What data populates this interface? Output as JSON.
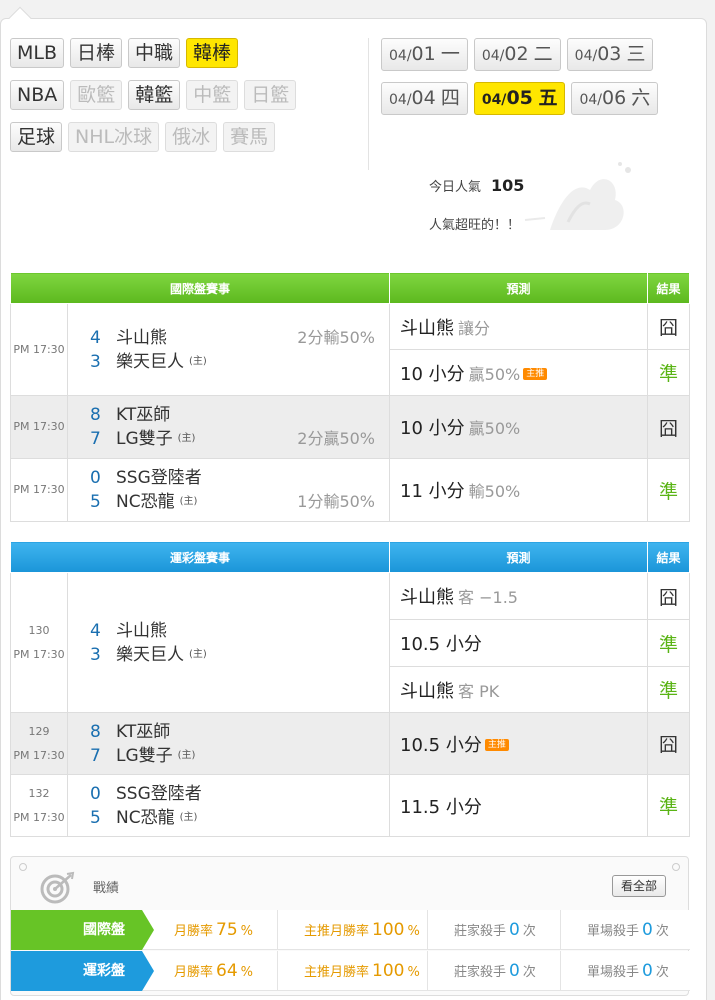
{
  "sport_tabs": {
    "row1": [
      "MLB",
      "日棒",
      "中職",
      "韓棒"
    ],
    "row2": [
      "NBA",
      "歐籃",
      "韓籃",
      "中籃",
      "日籃"
    ],
    "row3": [
      "足球",
      "NHL冰球",
      "俄冰",
      "賽馬"
    ]
  },
  "date_tabs": [
    {
      "md": "04/",
      "day": "01",
      "wd": "一"
    },
    {
      "md": "04/",
      "day": "02",
      "wd": "二"
    },
    {
      "md": "04/",
      "day": "03",
      "wd": "三"
    },
    {
      "md": "04/",
      "day": "04",
      "wd": "四"
    },
    {
      "md": "04/",
      "day": "05",
      "wd": "五"
    },
    {
      "md": "04/",
      "day": "06",
      "wd": "六"
    }
  ],
  "popularity": {
    "label": "今日人氣",
    "value": "105",
    "message": "人氣超旺的！！"
  },
  "intl": {
    "headers": [
      "國際盤賽事",
      "預測",
      "結果"
    ],
    "games": [
      {
        "time": "PM 17:30",
        "away": {
          "score": "4",
          "name": "斗山熊"
        },
        "home": {
          "score": "3",
          "name": "樂天巨人",
          "mark": "(主)"
        },
        "handicap_top": "2分輸50%",
        "handicap_bottom": "",
        "preds": [
          {
            "main": "斗山熊",
            "sub": "讓分",
            "tag": "",
            "result": "囧"
          },
          {
            "main": "10 小分",
            "sub": "贏50%",
            "tag": "主推",
            "result": "準"
          }
        ]
      },
      {
        "time": "PM 17:30",
        "away": {
          "score": "8",
          "name": "KT巫師"
        },
        "home": {
          "score": "7",
          "name": "LG雙子",
          "mark": "(主)"
        },
        "handicap_top": "",
        "handicap_bottom": "2分贏50%",
        "preds": [
          {
            "main": "10 小分",
            "sub": "贏50%",
            "tag": "",
            "result": "囧"
          }
        ]
      },
      {
        "time": "PM 17:30",
        "away": {
          "score": "0",
          "name": "SSG登陸者"
        },
        "home": {
          "score": "5",
          "name": "NC恐龍",
          "mark": "(主)"
        },
        "handicap_top": "",
        "handicap_bottom": "1分輸50%",
        "preds": [
          {
            "main": "11 小分",
            "sub": "輸50%",
            "tag": "",
            "result": "準"
          }
        ]
      }
    ]
  },
  "lottery": {
    "headers": [
      "運彩盤賽事",
      "預測",
      "結果"
    ],
    "games": [
      {
        "no": "130",
        "time": "PM 17:30",
        "away": {
          "score": "4",
          "name": "斗山熊"
        },
        "home": {
          "score": "3",
          "name": "樂天巨人",
          "mark": "(主)"
        },
        "preds": [
          {
            "main": "斗山熊",
            "sub": "客 −1.5",
            "tag": "",
            "result": "囧"
          },
          {
            "main": "10.5 小分",
            "sub": "",
            "tag": "",
            "result": "準"
          },
          {
            "main": "斗山熊",
            "sub": "客 PK",
            "tag": "",
            "result": "準"
          }
        ]
      },
      {
        "no": "129",
        "time": "PM 17:30",
        "away": {
          "score": "8",
          "name": "KT巫師"
        },
        "home": {
          "score": "7",
          "name": "LG雙子",
          "mark": "(主)"
        },
        "preds": [
          {
            "main": "10.5 小分",
            "sub": "",
            "tag": "主推",
            "result": "囧"
          }
        ]
      },
      {
        "no": "132",
        "time": "PM 17:30",
        "away": {
          "score": "0",
          "name": "SSG登陸者"
        },
        "home": {
          "score": "5",
          "name": "NC恐龍",
          "mark": "(主)"
        },
        "preds": [
          {
            "main": "11.5 小分",
            "sub": "",
            "tag": "",
            "result": "準"
          }
        ]
      }
    ]
  },
  "record": {
    "title": "戰績",
    "view_all": "看全部",
    "rows": [
      {
        "label": "國際盤",
        "month_label": "月勝率",
        "month_value": "75",
        "main_label": "主推月勝率",
        "main_value": "100",
        "pct": "%",
        "banker_label": "莊家殺手",
        "banker_value": "0",
        "single_label": "單場殺手",
        "single_value": "0",
        "unit": "次"
      },
      {
        "label": "運彩盤",
        "month_label": "月勝率",
        "month_value": "64",
        "main_label": "主推月勝率",
        "main_value": "100",
        "pct": "%",
        "banker_label": "莊家殺手",
        "banker_value": "0",
        "single_label": "單場殺手",
        "single_value": "0",
        "unit": "次"
      }
    ]
  }
}
